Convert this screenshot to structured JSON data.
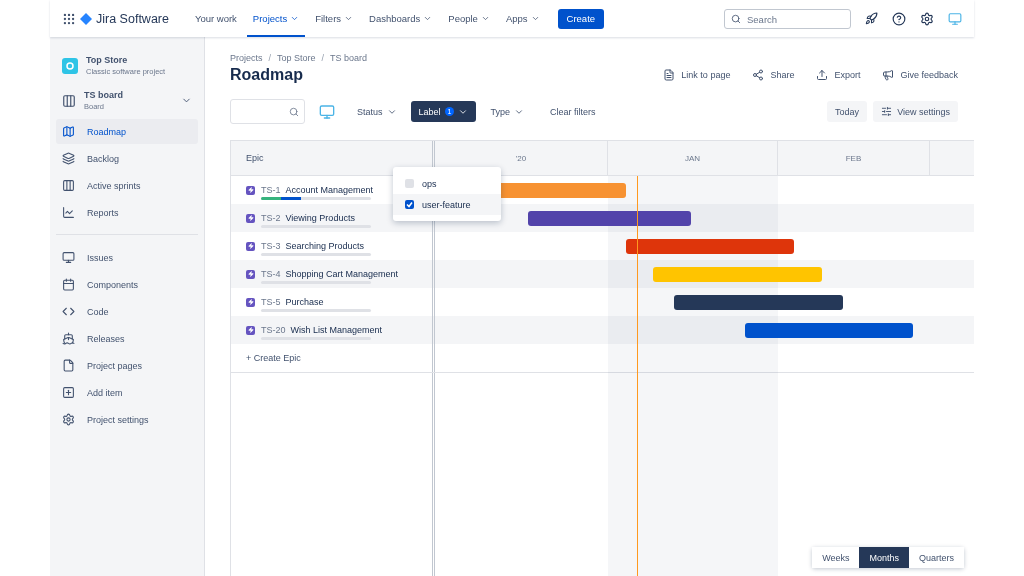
{
  "topnav": {
    "product": "Jira Software",
    "items": [
      {
        "label": "Your work",
        "selected": false,
        "dropdown": false
      },
      {
        "label": "Projects",
        "selected": true,
        "dropdown": true
      },
      {
        "label": "Filters",
        "selected": false,
        "dropdown": true
      },
      {
        "label": "Dashboards",
        "selected": false,
        "dropdown": true
      },
      {
        "label": "People",
        "selected": false,
        "dropdown": true
      },
      {
        "label": "Apps",
        "selected": false,
        "dropdown": true
      }
    ],
    "create": "Create",
    "search": {
      "placeholder": "Search"
    }
  },
  "sidebar": {
    "project": {
      "name": "Top Store",
      "type": "Classic software project"
    },
    "board": {
      "name": "TS board",
      "type": "Board"
    },
    "items": [
      {
        "label": "Roadmap",
        "selected": true
      },
      {
        "label": "Backlog",
        "selected": false
      },
      {
        "label": "Active sprints",
        "selected": false
      },
      {
        "label": "Reports",
        "selected": false
      }
    ],
    "items2": [
      {
        "label": "Issues",
        "selected": false
      },
      {
        "label": "Components",
        "selected": false
      },
      {
        "label": "Code",
        "selected": false
      },
      {
        "label": "Releases",
        "selected": false
      },
      {
        "label": "Project pages",
        "selected": false
      },
      {
        "label": "Add item",
        "selected": false
      },
      {
        "label": "Project settings",
        "selected": false
      }
    ]
  },
  "breadcrumbs": [
    {
      "kind": "link",
      "text": "Projects"
    },
    {
      "kind": "separator",
      "text": "/"
    },
    {
      "kind": "link",
      "text": "Top Store"
    },
    {
      "kind": "separator",
      "text": "/"
    },
    {
      "kind": "link",
      "text": "TS board"
    }
  ],
  "title": "Roadmap",
  "actions": [
    "Link to page",
    "Share",
    "Export",
    "Give feedback"
  ],
  "filters": [
    {
      "label": "Status",
      "active": false
    },
    {
      "label": "Label",
      "active": true,
      "count": "1"
    },
    {
      "label": "Type",
      "active": false
    }
  ],
  "clear_filters": "Clear filters",
  "today": "Today",
  "view_settings": "View settings",
  "label_menu": [
    {
      "label": "ops",
      "checked": false
    },
    {
      "label": "user-feature",
      "checked": true
    }
  ],
  "table": {
    "epic_header": "Epic",
    "months": [
      "'20",
      "JAN",
      "FEB"
    ],
    "epics": [
      {
        "key": "TS-1",
        "name": "Account Management",
        "color": "#f79232",
        "progress": [
          {
            "kind": "done",
            "level": 0.18
          },
          {
            "kind": "in_progress",
            "level": 0.18
          }
        ]
      },
      {
        "key": "TS-2",
        "name": "Viewing Products",
        "color": "#5243aa",
        "progress": [
          {
            "kind": "done",
            "level": 0
          },
          {
            "kind": "in_progress",
            "level": 0
          }
        ]
      },
      {
        "key": "TS-3",
        "name": "Searching Products",
        "color": "#de350b",
        "progress": [
          {
            "kind": "done",
            "level": 0
          },
          {
            "kind": "in_progress",
            "level": 0
          }
        ]
      },
      {
        "key": "TS-4",
        "name": "Shopping Cart Management",
        "color": "#ffc400",
        "progress": [
          {
            "kind": "done",
            "level": 0
          },
          {
            "kind": "in_progress",
            "level": 0
          }
        ]
      },
      {
        "key": "TS-5",
        "name": "Purchase",
        "color": "#253858",
        "progress": [
          {
            "kind": "done",
            "level": 0
          },
          {
            "kind": "in_progress",
            "level": 0
          }
        ]
      },
      {
        "key": "TS-20",
        "name": "Wish List Management",
        "color": "#0052cc",
        "progress": [
          {
            "kind": "done",
            "level": 0
          },
          {
            "kind": "in_progress",
            "level": 0
          }
        ]
      }
    ],
    "create_epic": "+ Create Epic"
  },
  "timescale": [
    {
      "label": "Weeks",
      "selected": false
    },
    {
      "label": "Months",
      "selected": true
    },
    {
      "label": "Quarters",
      "selected": false
    }
  ]
}
